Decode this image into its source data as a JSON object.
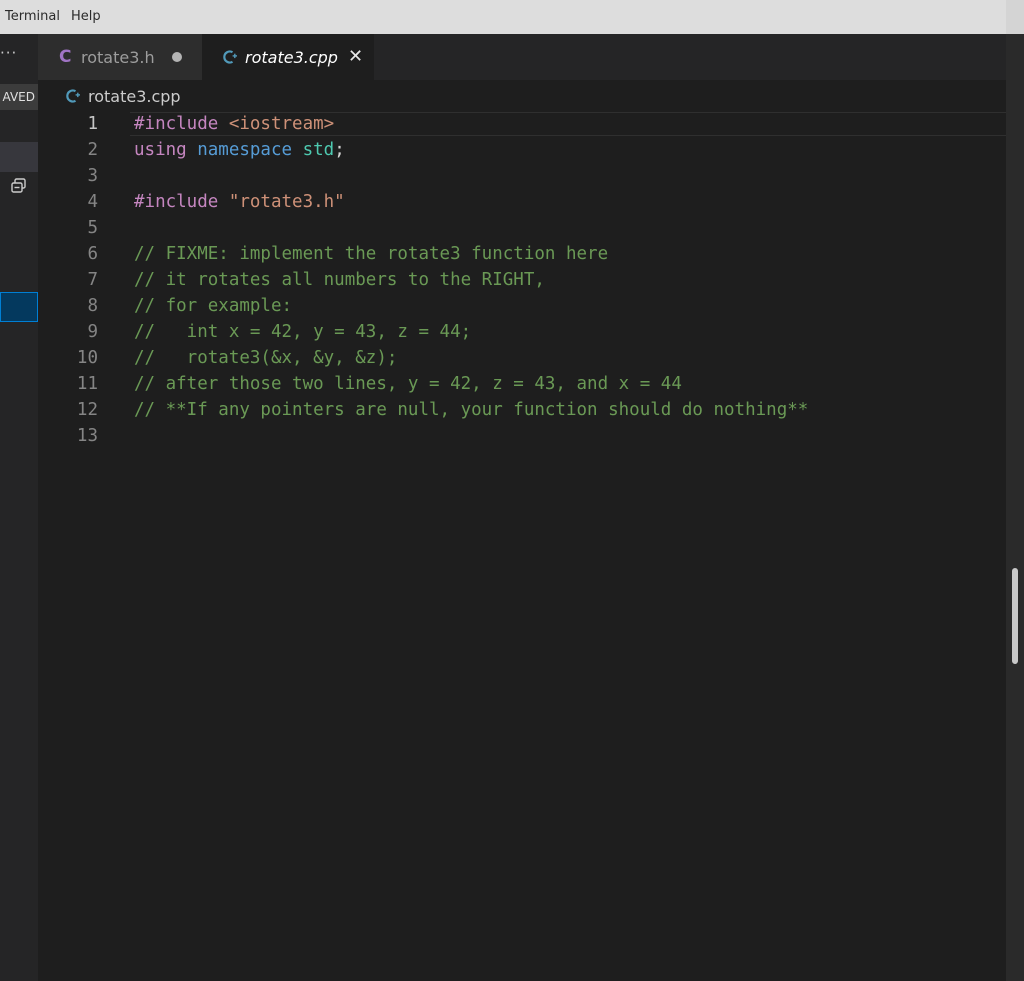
{
  "menubar": {
    "items": [
      "Terminal",
      "Help"
    ]
  },
  "sidebar": {
    "more_label": "···",
    "saved_badge": "AVED"
  },
  "tabs": [
    {
      "label": "rotate3.h",
      "icon": "c-file-icon",
      "icon_text": "C",
      "dirty": true
    },
    {
      "label": "rotate3.cpp",
      "icon": "cpp-file-icon",
      "active": true,
      "close_glyph": "✕"
    }
  ],
  "breadcrumb": {
    "file": "rotate3.cpp",
    "icon": "cpp-file-icon"
  },
  "editor": {
    "active_line": 1,
    "lines": [
      {
        "n": "1",
        "tokens": [
          {
            "t": "#include ",
            "k": "preproc"
          },
          {
            "t": "<iostream>",
            "k": "string"
          }
        ]
      },
      {
        "n": "2",
        "tokens": [
          {
            "t": "using ",
            "k": "keyword"
          },
          {
            "t": "namespace ",
            "k": "ns"
          },
          {
            "t": "std",
            "k": "type"
          },
          {
            "t": ";",
            "k": "punct"
          }
        ]
      },
      {
        "n": "3",
        "tokens": []
      },
      {
        "n": "4",
        "tokens": [
          {
            "t": "#include ",
            "k": "preproc"
          },
          {
            "t": "\"rotate3.h\"",
            "k": "string"
          }
        ]
      },
      {
        "n": "5",
        "tokens": []
      },
      {
        "n": "6",
        "tokens": [
          {
            "t": "// FIXME: implement the rotate3 function here",
            "k": "comment"
          }
        ]
      },
      {
        "n": "7",
        "tokens": [
          {
            "t": "// it rotates all numbers to the RIGHT,",
            "k": "comment"
          }
        ]
      },
      {
        "n": "8",
        "tokens": [
          {
            "t": "// for example:",
            "k": "comment"
          }
        ]
      },
      {
        "n": "9",
        "tokens": [
          {
            "t": "//   int x = 42, y = 43, z = 44;",
            "k": "comment"
          }
        ]
      },
      {
        "n": "10",
        "tokens": [
          {
            "t": "//   rotate3(&x, &y, &z);",
            "k": "comment"
          }
        ]
      },
      {
        "n": "11",
        "tokens": [
          {
            "t": "// after those two lines, y = 42, z = 43, and x = 44",
            "k": "comment"
          }
        ]
      },
      {
        "n": "12",
        "tokens": [
          {
            "t": "// **If any pointers are null, your function should do nothing**",
            "k": "comment"
          }
        ]
      },
      {
        "n": "13",
        "tokens": []
      }
    ]
  },
  "colors": {
    "editor_bg": "#1e1e1e",
    "comment": "#6a9955",
    "preproc": "#c586c0",
    "string": "#ce9178",
    "namespace": "#569cd6",
    "type": "#4ec9b0",
    "selection_border": "#007fd4"
  }
}
